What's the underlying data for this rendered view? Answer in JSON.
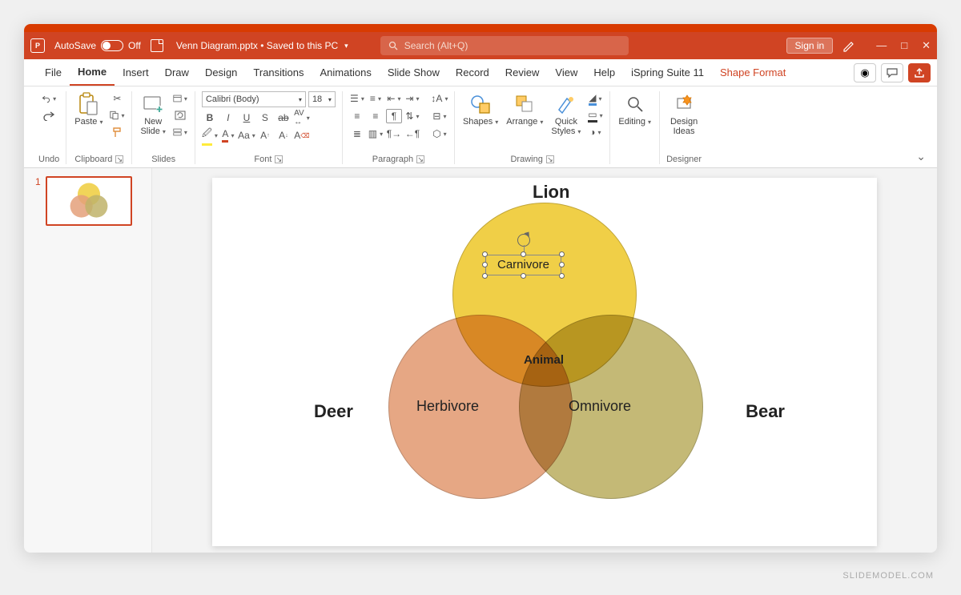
{
  "titlebar": {
    "autosave_label": "AutoSave",
    "autosave_state": "Off",
    "document_title": "Venn Diagram.pptx • Saved to this PC",
    "search_placeholder": "Search (Alt+Q)",
    "sign_in": "Sign in"
  },
  "tabs": {
    "file": "File",
    "home": "Home",
    "insert": "Insert",
    "draw": "Draw",
    "design": "Design",
    "transitions": "Transitions",
    "animations": "Animations",
    "slideshow": "Slide Show",
    "record": "Record",
    "review": "Review",
    "view": "View",
    "help": "Help",
    "ispring": "iSpring Suite 11",
    "shape_format": "Shape Format"
  },
  "ribbon": {
    "undo": "Undo",
    "clipboard": "Clipboard",
    "paste": "Paste",
    "slides": "Slides",
    "new_slide": "New\nSlide",
    "font_group": "Font",
    "font_name": "Calibri (Body)",
    "font_size": "18",
    "paragraph": "Paragraph",
    "drawing": "Drawing",
    "shapes": "Shapes",
    "arrange": "Arrange",
    "quick_styles": "Quick\nStyles",
    "editing": "Editing",
    "designer": "Designer",
    "design_ideas": "Design\nIdeas"
  },
  "thumbnail_number": "1",
  "venn": {
    "title_top": "Lion",
    "title_left": "Deer",
    "title_right": "Bear",
    "label_top": "Carnivore",
    "label_left": "Herbivore",
    "label_right": "Omnivore",
    "center": "Animal"
  },
  "watermark": "SLIDEMODEL.COM",
  "chart_data": {
    "type": "venn",
    "sets": [
      {
        "name": "Lion",
        "label": "Carnivore",
        "color": "#f0cf47"
      },
      {
        "name": "Deer",
        "label": "Herbivore",
        "color": "#e4a07a"
      },
      {
        "name": "Bear",
        "label": "Omnivore",
        "color": "#bfb36a"
      }
    ],
    "intersection_label": "Animal",
    "title": ""
  }
}
